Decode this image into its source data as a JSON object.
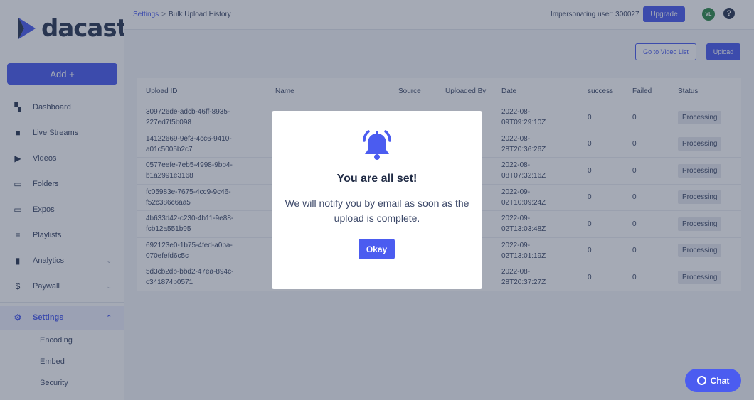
{
  "brand": {
    "name": "dacast",
    "accent": "#4b5cf0",
    "dark": "#2a3754"
  },
  "sidebar": {
    "add_label": "Add +",
    "items": [
      {
        "label": "Dashboard",
        "icon": "dashboard-icon",
        "glyph": "▚"
      },
      {
        "label": "Live Streams",
        "icon": "live-streams-icon",
        "glyph": "■"
      },
      {
        "label": "Videos",
        "icon": "videos-icon",
        "glyph": "▶"
      },
      {
        "label": "Folders",
        "icon": "folders-icon",
        "glyph": "▭"
      },
      {
        "label": "Expos",
        "icon": "expos-icon",
        "glyph": "▭"
      },
      {
        "label": "Playlists",
        "icon": "playlists-icon",
        "glyph": "≡"
      },
      {
        "label": "Analytics",
        "icon": "analytics-icon",
        "glyph": "▮"
      },
      {
        "label": "Paywall",
        "icon": "paywall-icon",
        "glyph": "$"
      }
    ],
    "settings": {
      "label": "Settings",
      "icon": "gear-icon",
      "glyph": "⚙"
    },
    "sub_items": [
      {
        "label": "Encoding"
      },
      {
        "label": "Embed"
      },
      {
        "label": "Security"
      }
    ]
  },
  "header": {
    "breadcrumb_root": "Settings",
    "breadcrumb_sep": ">",
    "breadcrumb_current": "Bulk Upload History",
    "impersonating": "Impersonating user: 300027",
    "upgrade_label": "Upgrade",
    "avatar_initials": "VL",
    "help_glyph": "?"
  },
  "actions": {
    "goto_label": "Go to Video List",
    "upload_label": "Upload"
  },
  "table": {
    "columns": [
      "Upload ID",
      "Name",
      "Source",
      "Uploaded By",
      "Date",
      "success",
      "Failed",
      "Status"
    ],
    "rows": [
      {
        "id1": "309726de-adcb-46ff-8935-",
        "id2": "227ed7f5b098",
        "d1": "2022-08-",
        "d2": "09T09:29:10Z",
        "success": "0",
        "failed": "0",
        "status": "Processing"
      },
      {
        "id1": "14122669-9ef3-4cc6-9410-",
        "id2": "a01c5005b2c7",
        "d1": "2022-08-",
        "d2": "28T20:36:26Z",
        "success": "0",
        "failed": "0",
        "status": "Processing"
      },
      {
        "id1": "0577eefe-7eb5-4998-9bb4-",
        "id2": "b1a2991e3168",
        "d1": "2022-08-",
        "d2": "08T07:32:16Z",
        "success": "0",
        "failed": "0",
        "status": "Processing"
      },
      {
        "id1": "fc05983e-7675-4cc9-9c46-",
        "id2": "f52c386c6aa5",
        "d1": "2022-09-",
        "d2": "02T10:09:24Z",
        "success": "0",
        "failed": "0",
        "status": "Processing"
      },
      {
        "id1": "4b633d42-c230-4b11-9e88-",
        "id2": "fcb12a551b95",
        "d1": "2022-09-",
        "d2": "02T13:03:48Z",
        "success": "0",
        "failed": "0",
        "status": "Processing"
      },
      {
        "id1": "692123e0-1b75-4fed-a0ba-",
        "id2": "070efefd6c5c",
        "d1": "2022-09-",
        "d2": "02T13:01:19Z",
        "success": "0",
        "failed": "0",
        "status": "Processing"
      },
      {
        "id1": "5d3cb2db-bbd2-47ea-894c-",
        "id2": "c341874b0571",
        "d1": "2022-08-",
        "d2": "28T20:37:27Z",
        "success": "0",
        "failed": "0",
        "status": "Processing"
      }
    ]
  },
  "modal": {
    "icon": "bell-icon",
    "title": "You are all set!",
    "message": "We will notify you by email as soon as the upload is complete.",
    "ok_label": "Okay"
  },
  "chat": {
    "label": "Chat",
    "icon": "chat-bubble-icon"
  }
}
